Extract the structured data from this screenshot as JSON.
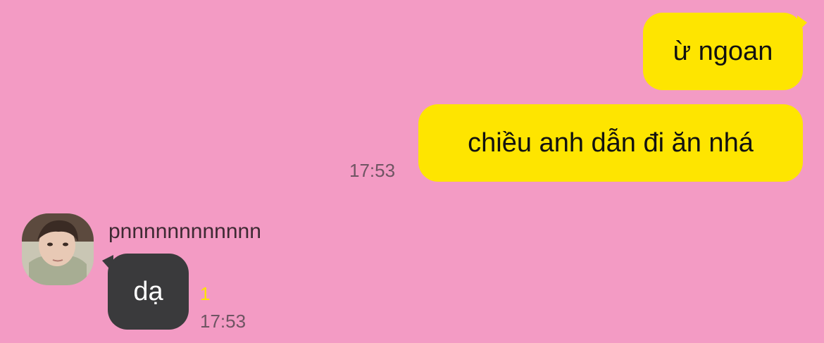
{
  "chat": {
    "messages": [
      {
        "direction": "sent",
        "text": "ừ ngoan"
      },
      {
        "direction": "sent",
        "text": "chiều anh dẫn đi ăn nhá",
        "time": "17:53"
      },
      {
        "direction": "received",
        "sender": "pnnnnnnnnnnnn",
        "text": "dạ",
        "unread": "1",
        "time": "17:53"
      }
    ]
  },
  "colors": {
    "background": "#f39bc4",
    "sent_bubble": "#fee500",
    "received_bubble": "#3a3a3c",
    "unread_count": "#fee500"
  },
  "icons": {
    "avatar": "user-photo-avatar"
  }
}
